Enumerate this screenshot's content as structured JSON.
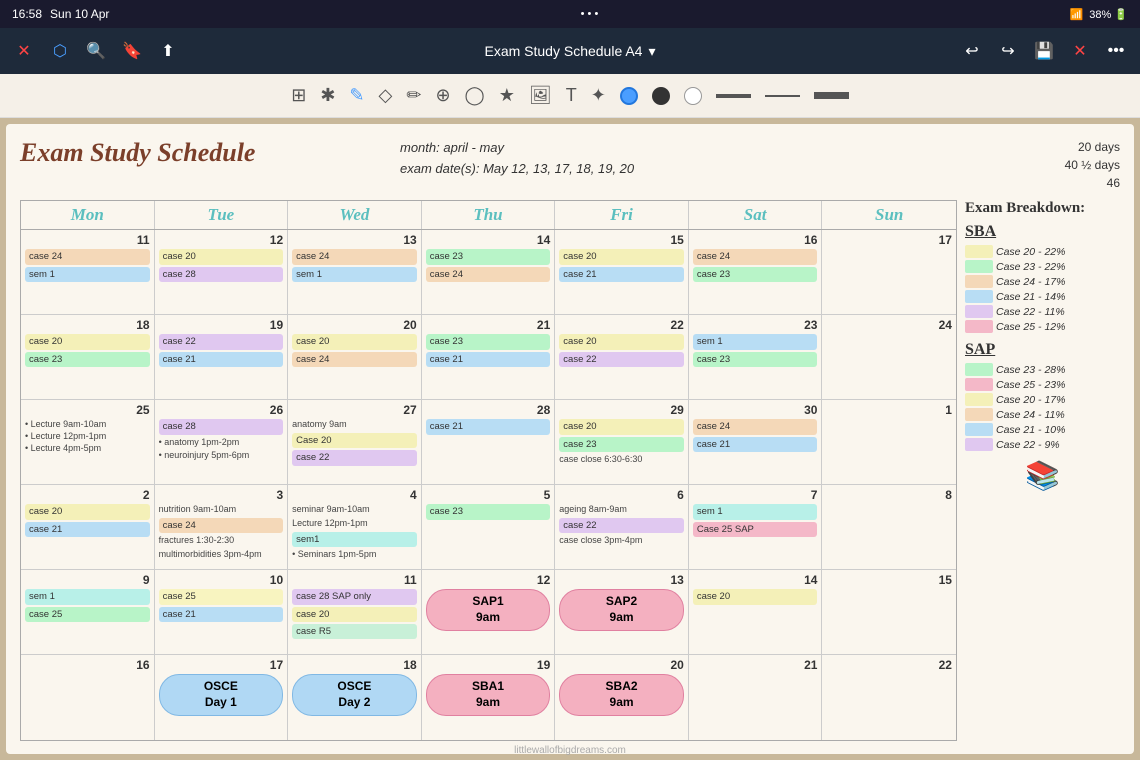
{
  "statusBar": {
    "time": "16:58",
    "day": "Sun 10 Apr",
    "title": "Exam Study Schedule A4",
    "wifi": "📶",
    "battery": "38%"
  },
  "header": {
    "title": "Exam Study Schedule",
    "month": "month: april - may",
    "examDates": "exam date(s): May 12, 13, 17, 18, 19, 20",
    "stats": "20 days\n40 ½ days\n46"
  },
  "days": [
    "Mon",
    "Tue",
    "Wed",
    "Thu",
    "Fri",
    "Sat",
    "Sun"
  ],
  "sidebar": {
    "title": "Exam Breakdown:",
    "sba": {
      "label": "SBA",
      "items": [
        {
          "case": "Case 20",
          "pct": "22%",
          "color": "light-yellow"
        },
        {
          "case": "Case 23",
          "pct": "22%",
          "color": "light-green"
        },
        {
          "case": "Case 24",
          "pct": "17%",
          "color": "light-orange"
        },
        {
          "case": "Case 21",
          "pct": "14%",
          "color": "light-blue"
        },
        {
          "case": "Case 22",
          "pct": "11%",
          "color": "lavender"
        },
        {
          "case": "Case 25",
          "pct": "12%",
          "color": "pink"
        }
      ]
    },
    "sap": {
      "label": "SAP",
      "items": [
        {
          "case": "Case 23",
          "pct": "28%",
          "color": "light-green"
        },
        {
          "case": "Case 25",
          "pct": "23%",
          "color": "pink"
        },
        {
          "case": "Case 20",
          "pct": "17%",
          "color": "light-yellow"
        },
        {
          "case": "Case 24",
          "pct": "11%",
          "color": "light-orange"
        },
        {
          "case": "Case 21",
          "pct": "10%",
          "color": "light-blue"
        },
        {
          "case": "Case 22",
          "pct": "9%",
          "color": "lavender"
        }
      ]
    }
  }
}
